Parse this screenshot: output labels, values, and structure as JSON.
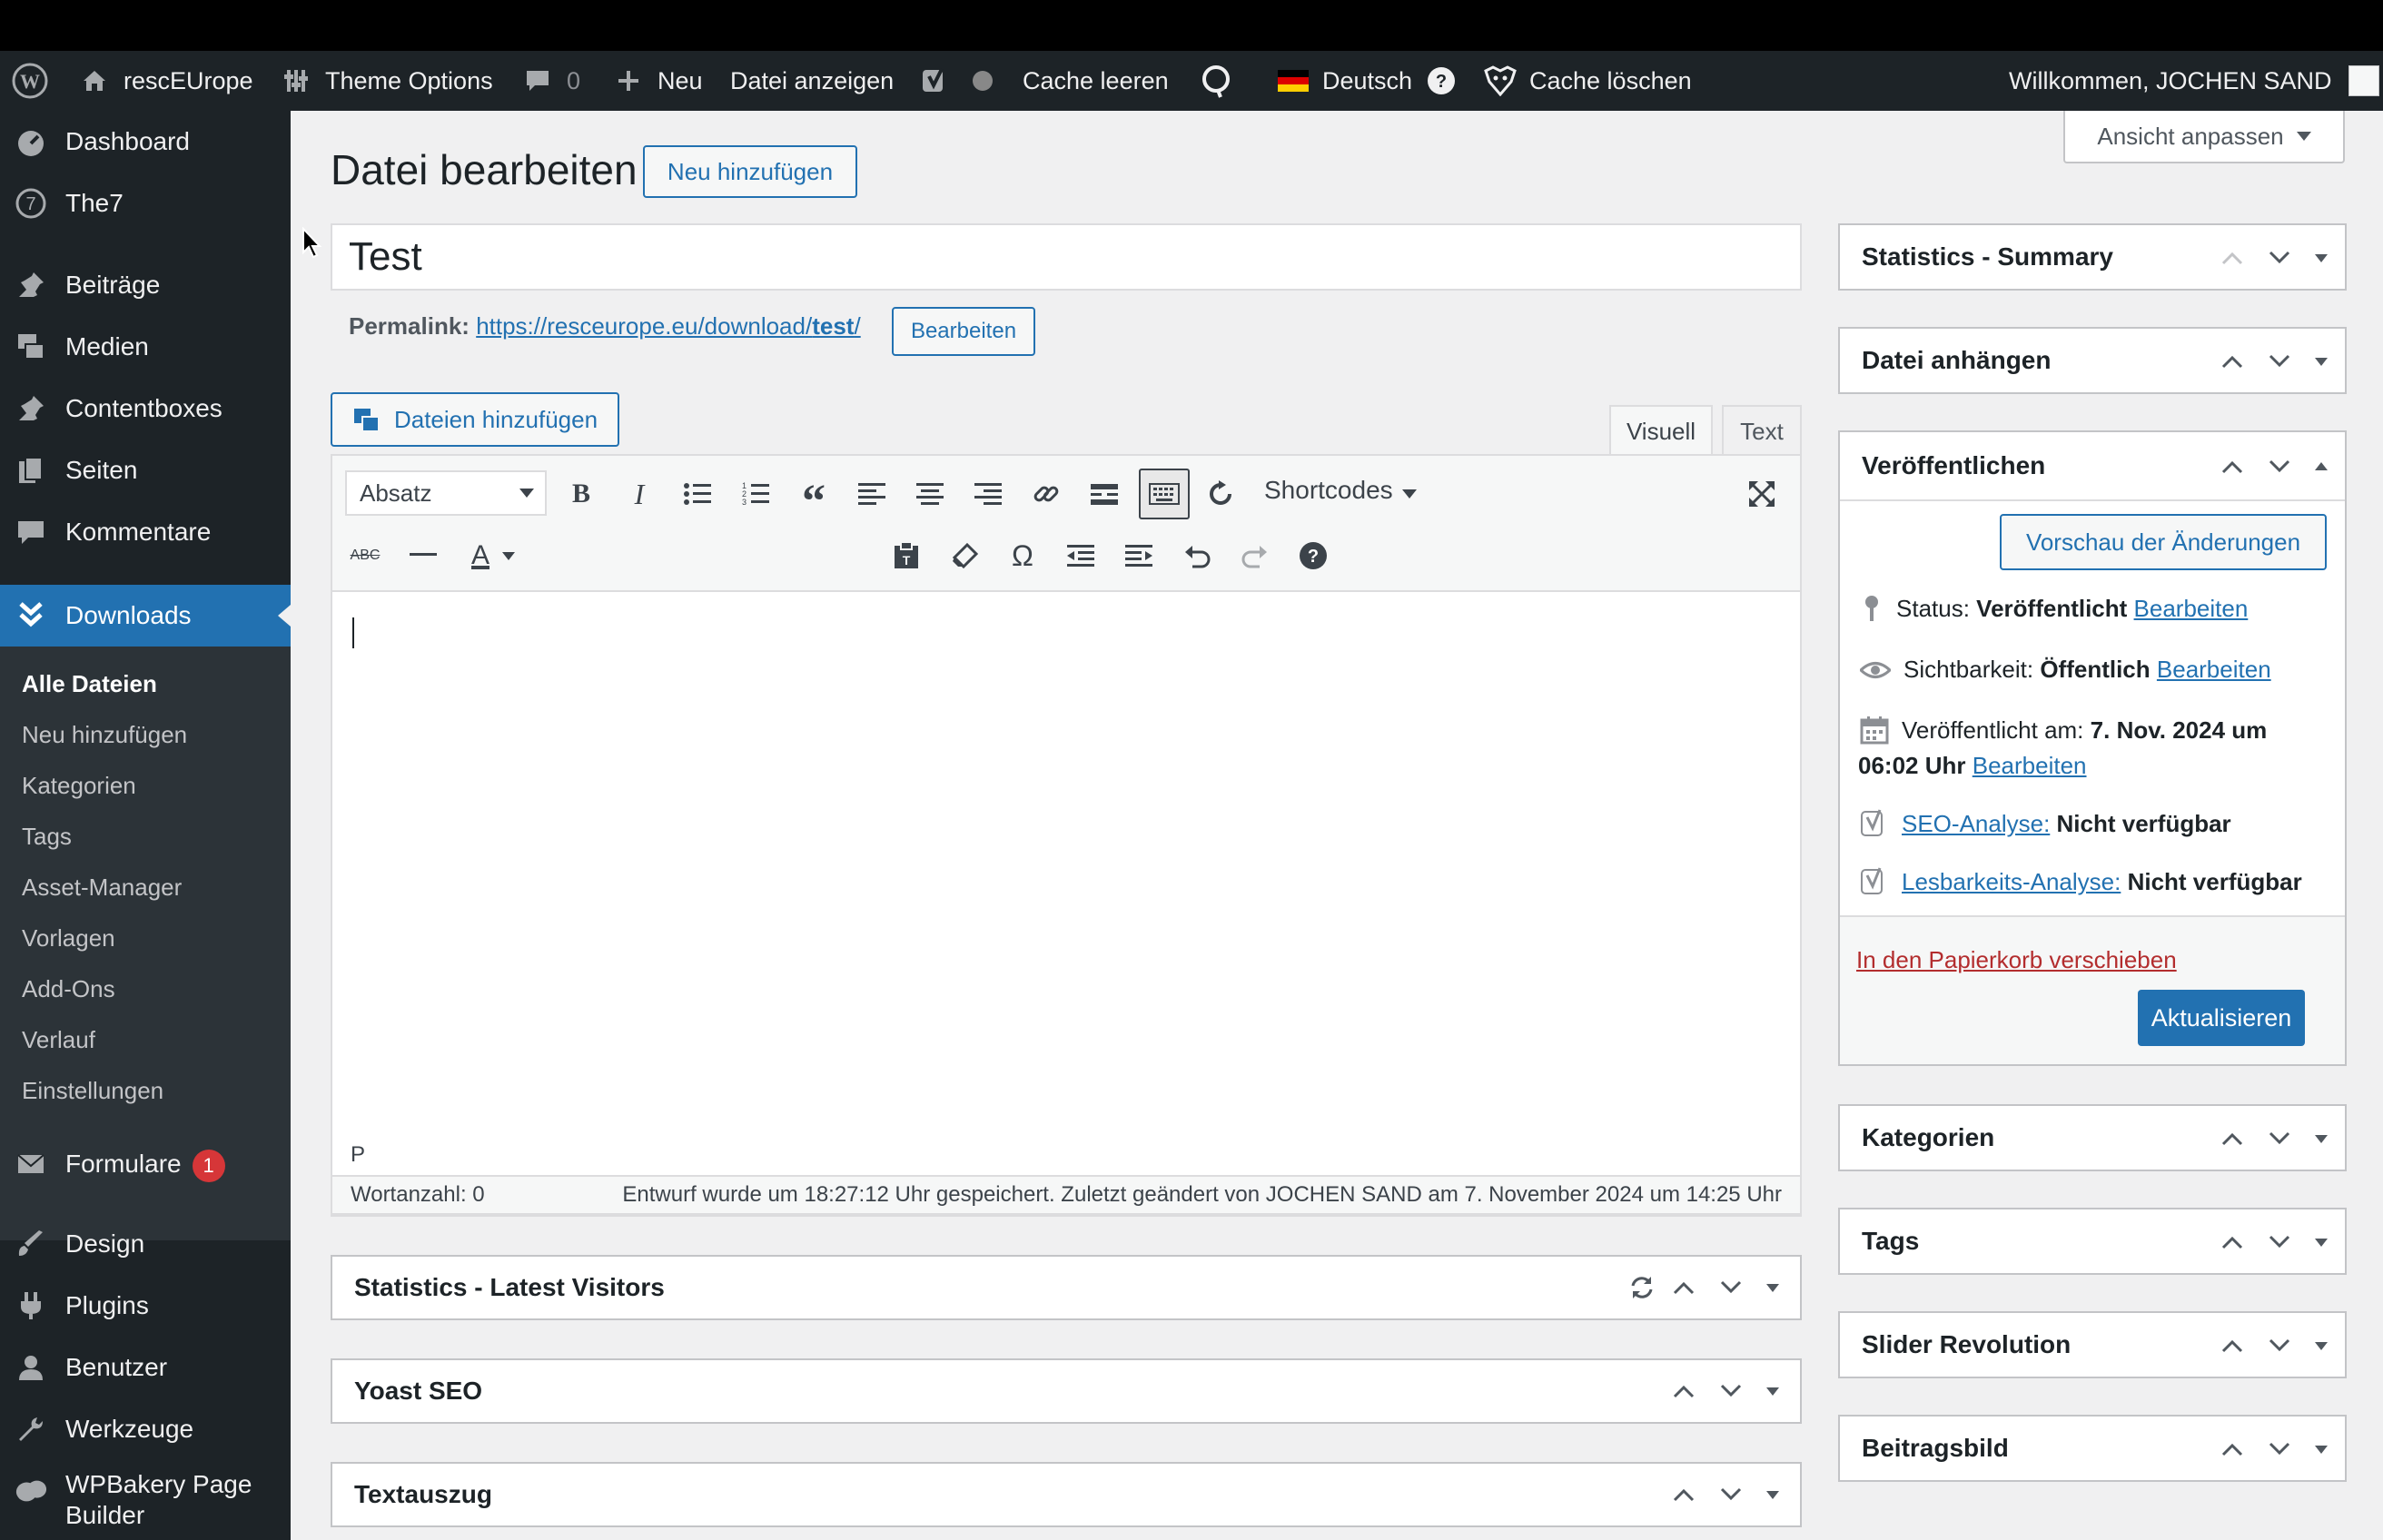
{
  "adminbar": {
    "site_name": "rescEUrope",
    "theme_options": "Theme Options",
    "comments_count": "0",
    "new_label": "Neu",
    "view_file": "Datei anzeigen",
    "cache_clear": "Cache leeren",
    "language": "Deutsch",
    "cache_delete": "Cache löschen",
    "welcome": "Willkommen, JOCHEN SAND"
  },
  "sidebar": {
    "items": [
      {
        "label": "Dashboard",
        "icon": "dashboard-icon"
      },
      {
        "label": "The7",
        "icon": "the7-icon"
      },
      {
        "label": "Beiträge",
        "icon": "pin-icon"
      },
      {
        "label": "Medien",
        "icon": "media-icon"
      },
      {
        "label": "Contentboxes",
        "icon": "pin-icon"
      },
      {
        "label": "Seiten",
        "icon": "pages-icon"
      },
      {
        "label": "Kommentare",
        "icon": "comment-icon"
      },
      {
        "label": "Downloads",
        "icon": "download-icon"
      }
    ],
    "submenu": [
      "Alle Dateien",
      "Neu hinzufügen",
      "Kategorien",
      "Tags",
      "Asset-Manager",
      "Vorlagen",
      "Add-Ons",
      "Verlauf",
      "Einstellungen"
    ],
    "items_bottom": [
      {
        "label": "Formulare",
        "icon": "mail-icon",
        "badge": "1"
      },
      {
        "label": "Design",
        "icon": "brush-icon"
      },
      {
        "label": "Plugins",
        "icon": "plugin-icon"
      },
      {
        "label": "Benutzer",
        "icon": "user-icon"
      },
      {
        "label": "Werkzeuge",
        "icon": "wrench-icon"
      },
      {
        "label": "WPBakery Page",
        "label2": "Builder",
        "icon": "wpbakery-icon"
      }
    ]
  },
  "screen_options": "Ansicht anpassen",
  "page": {
    "title": "Datei bearbeiten",
    "add_new": "Neu hinzufügen",
    "post_title": "Test",
    "permalink_label": "Permalink:",
    "permalink_base": "https://resceurope.eu/download/",
    "permalink_slug": "test",
    "permalink_trail": "/",
    "permalink_edit": "Bearbeiten"
  },
  "editor": {
    "add_files": "Dateien hinzufügen",
    "tab_visual": "Visuell",
    "tab_text": "Text",
    "format": "Absatz",
    "shortcodes": "Shortcodes",
    "path": "P",
    "word_count": "Wortanzahl: 0",
    "autosave": "Entwurf wurde um 18:27:12 Uhr gespeichert. Zuletzt geändert von JOCHEN SAND am 7. November 2024 um 14:25 Uhr"
  },
  "main_boxes": [
    "Statistics - Latest Visitors",
    "Yoast SEO",
    "Textauszug"
  ],
  "side_boxes": {
    "stats_summary": "Statistics - Summary",
    "attach": "Datei anhängen",
    "publish": "Veröffentlichen",
    "categories": "Kategorien",
    "tags": "Tags",
    "slider": "Slider Revolution",
    "featured": "Beitragsbild"
  },
  "publish": {
    "preview": "Vorschau der Änderungen",
    "status_label": "Status:",
    "status_value": "Veröffentlicht",
    "visibility_label": "Sichtbarkeit:",
    "visibility_value": "Öffentlich",
    "published_label": "Veröffentlicht am:",
    "published_value": "7. Nov. 2024 um",
    "published_time": "06:02 Uhr",
    "edit": "Bearbeiten",
    "seo_label": "SEO-Analyse:",
    "readability_label": "Lesbarkeits-Analyse:",
    "not_available": "Nicht verfügbar",
    "trash": "In den Papierkorb verschieben",
    "update": "Aktualisieren"
  },
  "colors": {
    "accent": "#2271b1",
    "sidebar": "#1d2327",
    "danger": "#b32d2e"
  }
}
